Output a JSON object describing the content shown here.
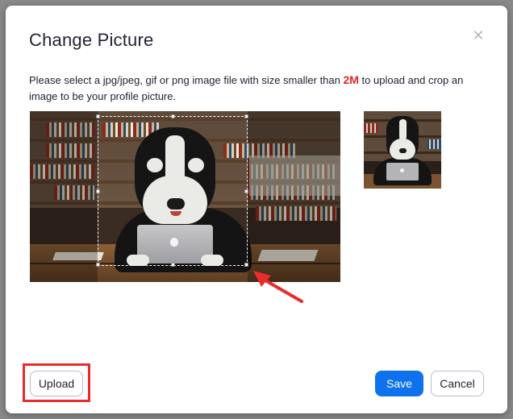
{
  "dialog": {
    "title": "Change Picture",
    "close_icon": "close-icon",
    "description": {
      "before": "Please select a jpg/jpeg, gif or png image file with size smaller than ",
      "highlight": "2M",
      "after": " to upload and crop an image to be your profile picture."
    },
    "highlight_color": "#e02828"
  },
  "image": {
    "subject": "mascot-with-laptop-photo",
    "preview": "profile-preview-thumbnail"
  },
  "annotations": {
    "arrow_color": "#e82c2c",
    "upload_highlight_color": "#e82c2c"
  },
  "buttons": {
    "upload_label": "Upload",
    "save_label": "Save",
    "cancel_label": "Cancel",
    "save_color": "#0e72ed"
  }
}
